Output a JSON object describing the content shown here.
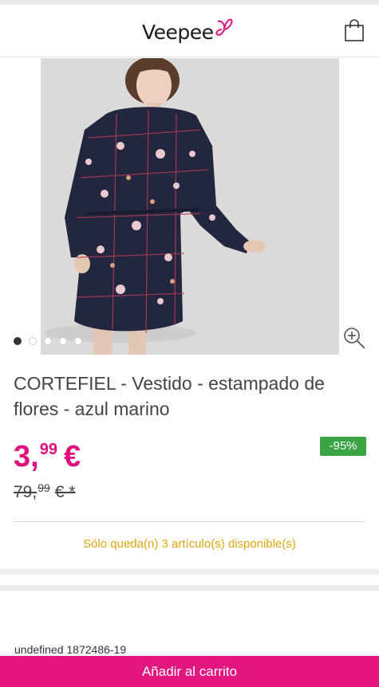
{
  "header": {
    "logo_text": "Veepee",
    "brand_color": "#e3157f",
    "cart_icon": "shopping-bag-icon"
  },
  "gallery": {
    "image_count": 5,
    "active_index": 0,
    "zoom_icon": "zoom-in-icon"
  },
  "product": {
    "title": "CORTEFIEL - Vestido - estampado de flores - azul marino",
    "price_integer": "3,",
    "price_cents": "99",
    "price_currency": "€",
    "old_price_integer": "79,",
    "old_price_cents": "99",
    "old_price_currency": "€ *",
    "discount": "-95%",
    "discount_color": "#3aa342",
    "stock_message": "Sólo queda(n) 3 artículo(s) disponible(s)",
    "stock_color": "#e2a710",
    "reference": "undefined 1872486-19"
  },
  "actions": {
    "add_to_cart": "Añadir al carrito"
  }
}
